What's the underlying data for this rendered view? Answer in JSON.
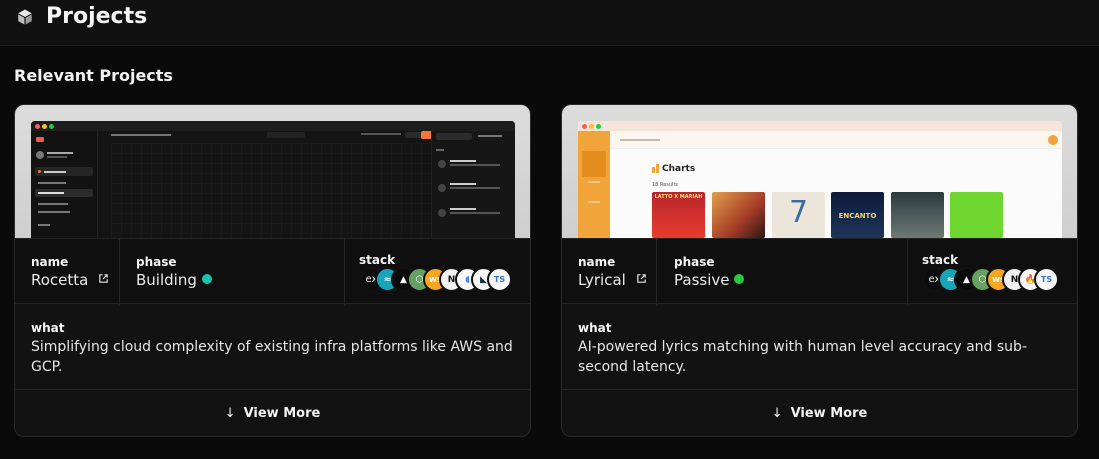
{
  "header": {
    "title": "Projects",
    "icon": "cube-icon"
  },
  "section": {
    "title": "Relevant Projects"
  },
  "labels": {
    "name": "name",
    "phase": "phase",
    "stack": "stack",
    "what": "what",
    "view_more": "View More"
  },
  "projects": [
    {
      "name": "Rocetta",
      "phase": "Building",
      "phase_color": "#19c3b0",
      "what": "Simplifying cloud complexity of existing infra platforms like AWS and GCP.",
      "stack": [
        "express",
        "tailwind",
        "nextjs-arrow",
        "nodejs",
        "websocket",
        "nginx",
        "gcp",
        "prisma",
        "typescript"
      ],
      "preview": {
        "breadcrumb": "Project Name / Playground",
        "env": "Production",
        "button": "Deploy",
        "tabs": [
          "Components",
          "Inspector"
        ],
        "sidebar_items": [
          "Launch an app",
          "Dashboard",
          "Playground",
          "Marketplace",
          "Billing & Usage",
          "Docs"
        ],
        "panel_items": [
          "Container",
          "Database",
          "Storage"
        ]
      }
    },
    {
      "name": "Lyrical",
      "phase": "Passive",
      "phase_color": "#27c93f",
      "what": "AI-powered lyrics matching with human level accuracy and sub-second latency.",
      "stack": [
        "express",
        "tailwind",
        "nextjs-arrow",
        "nodejs",
        "websocket",
        "nginx",
        "firebase",
        "typescript"
      ],
      "preview": {
        "search": "Search for songs",
        "heading": "Charts",
        "results": "18 Results",
        "albums": [
          "LATTO X MARIAH",
          "",
          "7",
          "ENCANTO",
          "",
          ""
        ]
      }
    }
  ],
  "colors": {
    "accent_orange": "#f6743c",
    "lyrical_orange": "#f0a43a",
    "background": "#0a0a0a",
    "card": "#121212"
  }
}
